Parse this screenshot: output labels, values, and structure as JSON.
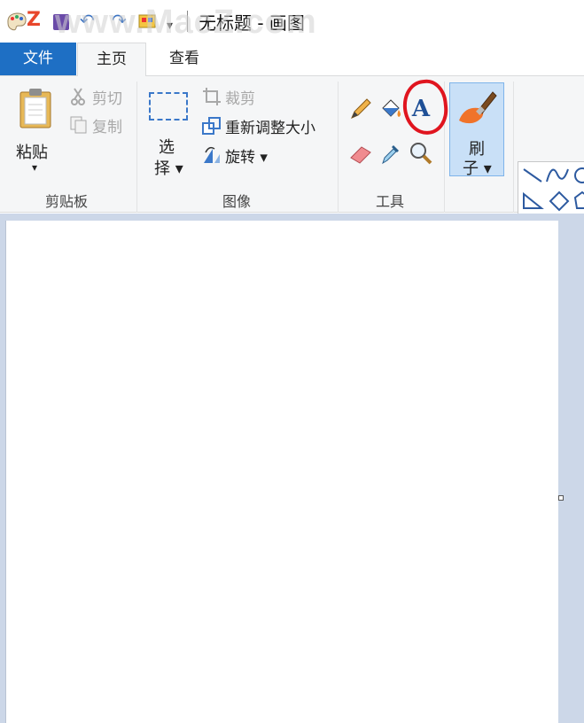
{
  "title_bar": {
    "title": "无标题 - 画图",
    "watermark": "www.MacZ.com",
    "quick_access": {
      "app_icon": "paint-app-icon",
      "z_logo": "Z",
      "save_icon": "save-icon",
      "undo_icon": "undo-icon",
      "redo_icon": "redo-icon",
      "color_icon": "palette-icon",
      "customize_arrow": "▾"
    }
  },
  "tabs": {
    "file": "文件",
    "home": "主页",
    "view": "查看"
  },
  "ribbon": {
    "clipboard": {
      "paste_label": "粘贴",
      "paste_arrow": "▾",
      "cut_label": "剪切",
      "copy_label": "复制",
      "group_label": "剪贴板"
    },
    "image": {
      "select_label_1": "选",
      "select_label_2": "择 ▾",
      "crop_label": "裁剪",
      "resize_label": "重新调整大小",
      "rotate_label": "旋转 ▾",
      "group_label": "图像"
    },
    "tools": {
      "text_tool_glyph": "A",
      "group_label": "工具",
      "icons": [
        "pencil-icon",
        "fill-bucket-icon",
        "text-icon",
        "eraser-icon",
        "color-picker-icon",
        "magnifier-icon"
      ]
    },
    "brushes": {
      "label_1": "刷",
      "label_2": "子 ▾"
    },
    "shapes": {
      "icons": [
        "line-icon",
        "curve-icon",
        "oval-icon",
        "triangle-icon",
        "diamond-icon",
        "pentagon-icon",
        "down-arrow-icon",
        "four-point-star-icon",
        "five-point-star-icon"
      ]
    }
  },
  "colors": {
    "file_tab": "#1e6fc4",
    "ribbon_bg": "#f5f6f7",
    "workspace_bg": "#ccd7e8",
    "annotation_circle": "#e0151f",
    "brush_selected": "#c9e0f7"
  }
}
